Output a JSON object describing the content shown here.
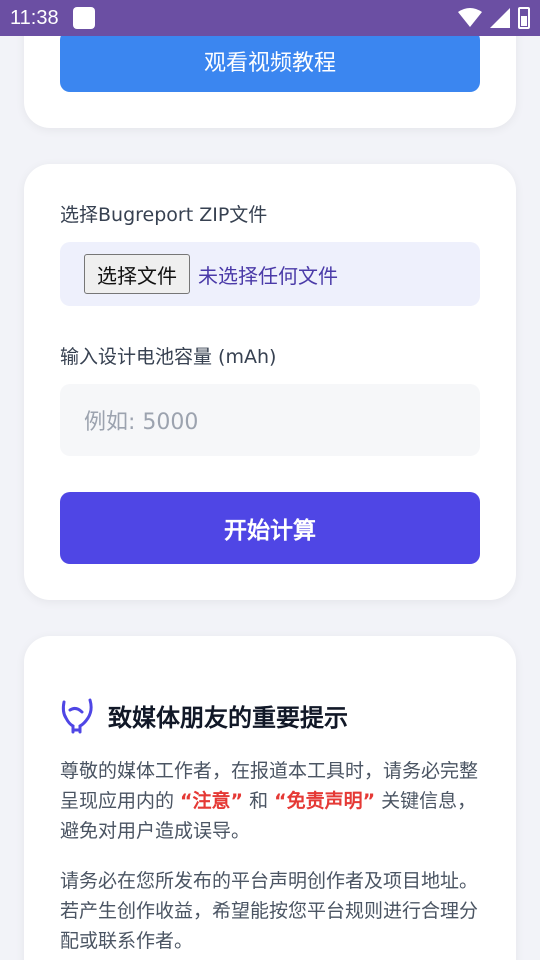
{
  "status_bar": {
    "time": "11:38"
  },
  "top_card": {
    "video_button": "观看视频教程"
  },
  "form": {
    "file_label": "选择Bugreport ZIP文件",
    "file_button": "选择文件",
    "file_status": "未选择任何文件",
    "capacity_label": "输入设计电池容量 (mAh)",
    "capacity_placeholder": "例如: 5000",
    "start_button": "开始计算"
  },
  "notice": {
    "title": "致媒体朋友的重要提示",
    "p1_a": "尊敬的媒体工作者，在报道本工具时，请务必完整呈现应用内的 ",
    "p1_hl1": "“注意”",
    "p1_b": " 和 ",
    "p1_hl2": "“免责声明”",
    "p1_c": " 关键信息，避免对用户造成误导。",
    "p2": "请务必在您所发布的平台声明创作者及项目地址。若产生创作收益，希望能按您平台规则进行合理分配或联系作者。"
  }
}
